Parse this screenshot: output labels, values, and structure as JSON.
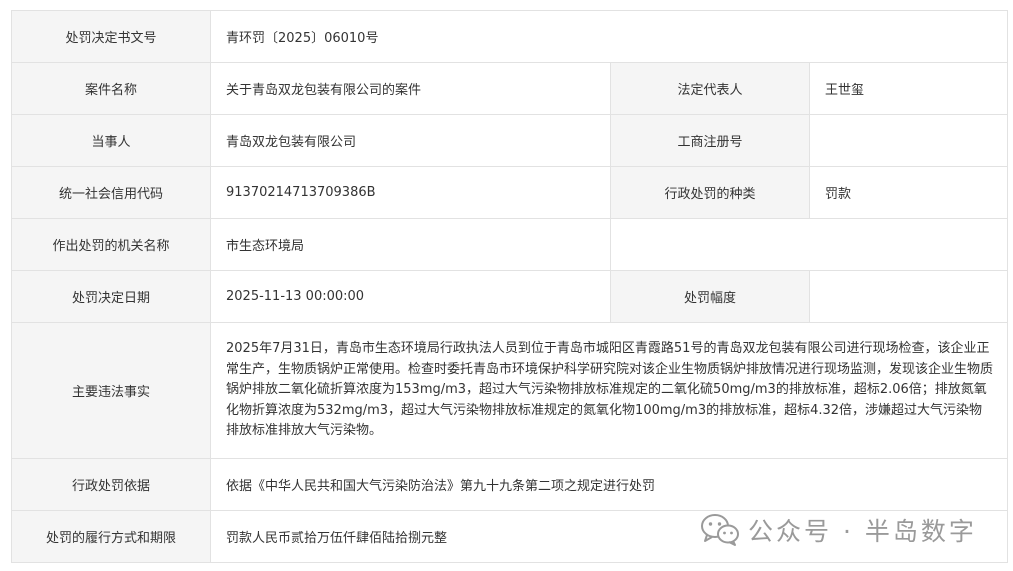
{
  "rows": {
    "decision_no": {
      "label": "处罚决定书文号",
      "value": "青环罚〔2025〕06010号"
    },
    "case_name": {
      "label": "案件名称",
      "value": "关于青岛双龙包装有限公司的案件"
    },
    "legal_rep": {
      "label": "法定代表人",
      "value": "王世玺"
    },
    "party": {
      "label": "当事人",
      "value": "青岛双龙包装有限公司"
    },
    "biz_reg_no": {
      "label": "工商注册号",
      "value": ""
    },
    "credit_code": {
      "label": "统一社会信用代码",
      "value": "91370214713709386B"
    },
    "penalty_type": {
      "label": "行政处罚的种类",
      "value": "罚款"
    },
    "authority": {
      "label": "作出处罚的机关名称",
      "value": "市生态环境局"
    },
    "decision_date": {
      "label": "处罚决定日期",
      "value": "2025-11-13 00:00:00"
    },
    "penalty_range": {
      "label": "处罚幅度",
      "value": ""
    },
    "facts": {
      "label": "主要违法事实",
      "value": "2025年7月31日，青岛市生态环境局行政执法人员到位于青岛市城阳区青霞路51号的青岛双龙包装有限公司进行现场检查，该企业正常生产，生物质锅炉正常使用。检查时委托青岛市环境保护科学研究院对该企业生物质锅炉排放情况进行现场监测，发现该企业生物质锅炉排放二氧化硫折算浓度为153mg/m3，超过大气污染物排放标准规定的二氧化硫50mg/m3的排放标准，超标2.06倍；排放氮氧化物折算浓度为532mg/m3，超过大气污染物排放标准规定的氮氧化物100mg/m3的排放标准，超标4.32倍，涉嫌超过大气污染物排放标准排放大气污染物。"
    },
    "basis": {
      "label": "行政处罚依据",
      "value": "依据《中华人民共和国大气污染防治法》第九十九条第二项之规定进行处罚"
    },
    "execution": {
      "label": "处罚的履行方式和期限",
      "value": "罚款人民币贰拾万伍仟肆佰陆拾捌元整"
    }
  },
  "watermark": {
    "text": "公众号 · 半岛数字",
    "icon": "wechat-icon"
  }
}
